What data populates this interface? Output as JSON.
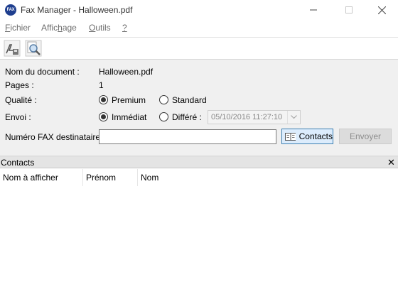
{
  "window": {
    "title": "Fax Manager - Halloween.pdf",
    "app_icon_text": "FAX"
  },
  "menu": [
    {
      "underline": "F",
      "rest": "ichier"
    },
    {
      "pre": "Affic",
      "underline": "h",
      "rest": "age"
    },
    {
      "underline": "O",
      "rest": "utils"
    },
    {
      "underline": "?",
      "rest": ""
    }
  ],
  "toolbar": {
    "icons": [
      "pdf-export-icon",
      "preview-magnifier-icon"
    ]
  },
  "form": {
    "doc_label": "Nom du document :",
    "doc_value": "Halloween.pdf",
    "pages_label": "Pages :",
    "pages_value": "1",
    "quality_label": "Qualité :",
    "quality_options": [
      "Premium",
      "Standard"
    ],
    "quality_selected": "Premium",
    "send_label": "Envoi :",
    "send_options": [
      "Immédiat",
      "Différé :"
    ],
    "send_selected": "Immédiat",
    "deferred_datetime": "05/10/2016 11:27:10",
    "fax_label": "Numéro FAX destinataire :",
    "fax_value": "",
    "contacts_button": "Contacts",
    "send_button": "Envoyer"
  },
  "contacts_panel": {
    "title": "Contacts",
    "columns": [
      "Nom à  afficher",
      "Prénom",
      "Nom"
    ],
    "rows": []
  },
  "colors": {
    "form_bg": "#f0f0f0",
    "accent_border": "#3c7fb1",
    "accent_fill": "#dcecfc",
    "disabled_text": "#8d8d8d"
  }
}
